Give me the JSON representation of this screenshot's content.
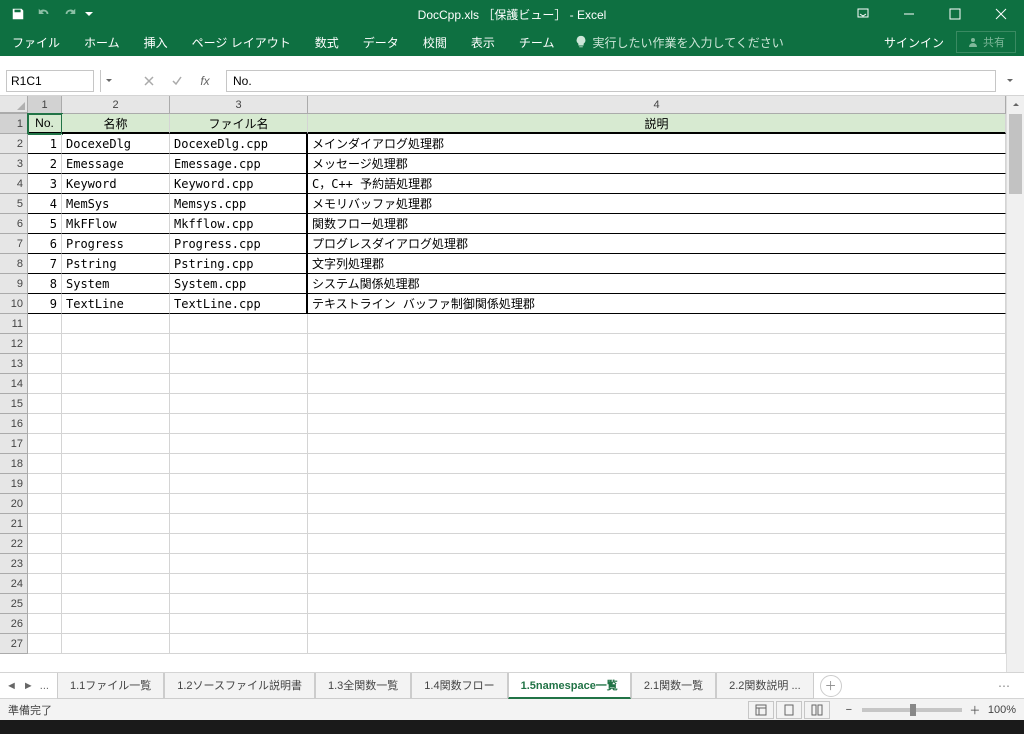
{
  "window": {
    "title": "DocCpp.xls ［保護ビュー］ - Excel",
    "signin": "サインイン",
    "share": "共有"
  },
  "ribbon": {
    "tabs": [
      "ファイル",
      "ホーム",
      "挿入",
      "ページ レイアウト",
      "数式",
      "データ",
      "校閲",
      "表示",
      "チーム"
    ],
    "tellme": "実行したい作業を入力してください"
  },
  "formula_bar": {
    "name_box": "R1C1",
    "formula": "No."
  },
  "columns": [
    "1",
    "2",
    "3",
    "4"
  ],
  "headers": {
    "no": "No.",
    "name": "名称",
    "file": "ファイル名",
    "desc": "説明"
  },
  "rows": [
    {
      "no": "1",
      "name": "DocexeDlg",
      "file": "DocexeDlg.cpp",
      "desc": "メインダイアログ処理郡"
    },
    {
      "no": "2",
      "name": "Emessage",
      "file": "Emessage.cpp",
      "desc": "メッセージ処理郡"
    },
    {
      "no": "3",
      "name": "Keyword",
      "file": "Keyword.cpp",
      "desc": "C，C++ 予約語処理郡"
    },
    {
      "no": "4",
      "name": "MemSys",
      "file": "Memsys.cpp",
      "desc": "メモリバッファ処理郡"
    },
    {
      "no": "5",
      "name": "MkFFlow",
      "file": "Mkfflow.cpp",
      "desc": "関数フロー処理郡"
    },
    {
      "no": "6",
      "name": "Progress",
      "file": "Progress.cpp",
      "desc": "プログレスダイアログ処理郡"
    },
    {
      "no": "7",
      "name": "Pstring",
      "file": "Pstring.cpp",
      "desc": "文字列処理郡"
    },
    {
      "no": "8",
      "name": "System",
      "file": "System.cpp",
      "desc": "システム関係処理郡"
    },
    {
      "no": "9",
      "name": "TextLine",
      "file": "TextLine.cpp",
      "desc": "テキストライン バッファ制御関係処理郡"
    }
  ],
  "empty_rows_start": 11,
  "empty_rows_end": 27,
  "sheet_tabs": {
    "ellipsis": "...",
    "items": [
      "1.1ファイル一覧",
      "1.2ソースファイル説明書",
      "1.3全関数一覧",
      "1.4関数フロー",
      "1.5namespace一覧",
      "2.1関数一覧",
      "2.2関数説明"
    ],
    "active_index": 4,
    "truncated_suffix": "..."
  },
  "statusbar": {
    "ready": "準備完了",
    "zoom": "100%"
  }
}
